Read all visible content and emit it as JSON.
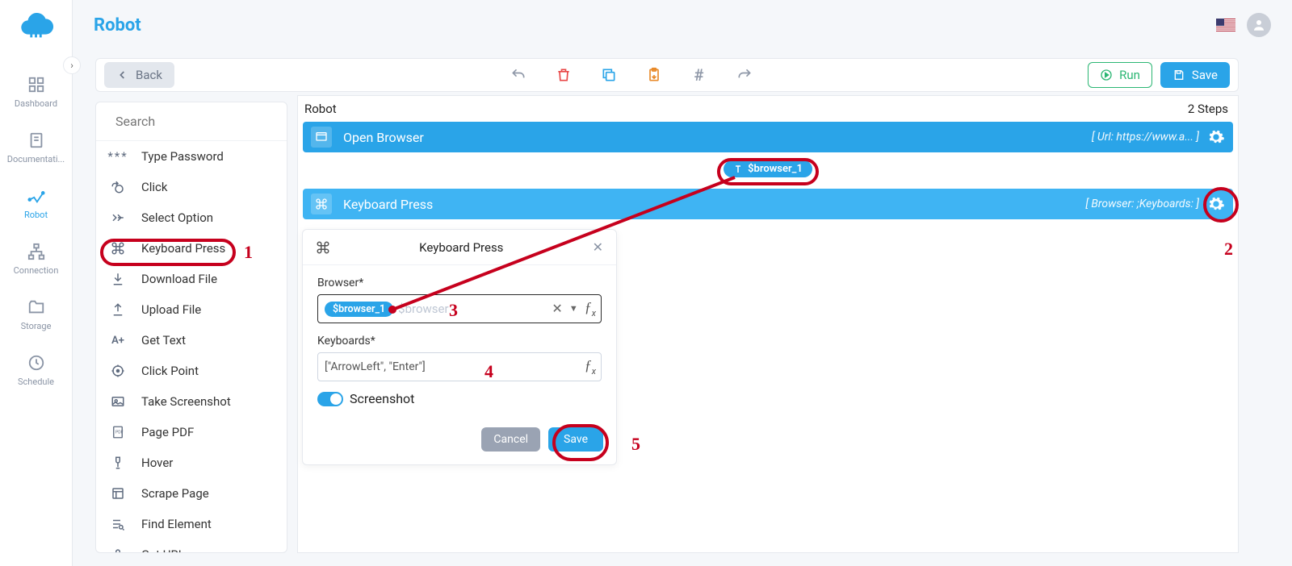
{
  "header": {
    "title": "Robot"
  },
  "rail": {
    "items": [
      {
        "label": "Dashboard"
      },
      {
        "label": "Documentati..."
      },
      {
        "label": "Robot"
      },
      {
        "label": "Connection"
      },
      {
        "label": "Storage"
      },
      {
        "label": "Schedule"
      }
    ]
  },
  "toolbar": {
    "back": "Back",
    "run": "Run",
    "save": "Save"
  },
  "panel": {
    "search_placeholder": "Search",
    "actions": [
      "Type Password",
      "Click",
      "Select Option",
      "Keyboard Press",
      "Download File",
      "Upload File",
      "Get Text",
      "Click Point",
      "Take Screenshot",
      "Page PDF",
      "Hover",
      "Scrape Page",
      "Find Element",
      "Get URL"
    ]
  },
  "canvas": {
    "title": "Robot",
    "steps_label": "2 Steps",
    "step1": {
      "name": "Open Browser",
      "detail": "[ Url: https://www.a... ]"
    },
    "var_chip": "$browser_1",
    "step2": {
      "name": "Keyboard Press",
      "detail": "[ Browser:  ;Keyboards: ]"
    }
  },
  "prop": {
    "title": "Keyboard Press",
    "browser_label": "Browser*",
    "browser_tag": "$browser_1",
    "browser_ghost": "$browser",
    "keyboards_label": "Keyboards*",
    "keyboards_value": "[\"ArrowLeft\", \"Enter\"]",
    "screenshot_label": "Screenshot",
    "cancel": "Cancel",
    "save": "Save"
  },
  "annotations": {
    "n1": "1",
    "n2": "2",
    "n3": "3",
    "n4": "4",
    "n5": "5"
  }
}
